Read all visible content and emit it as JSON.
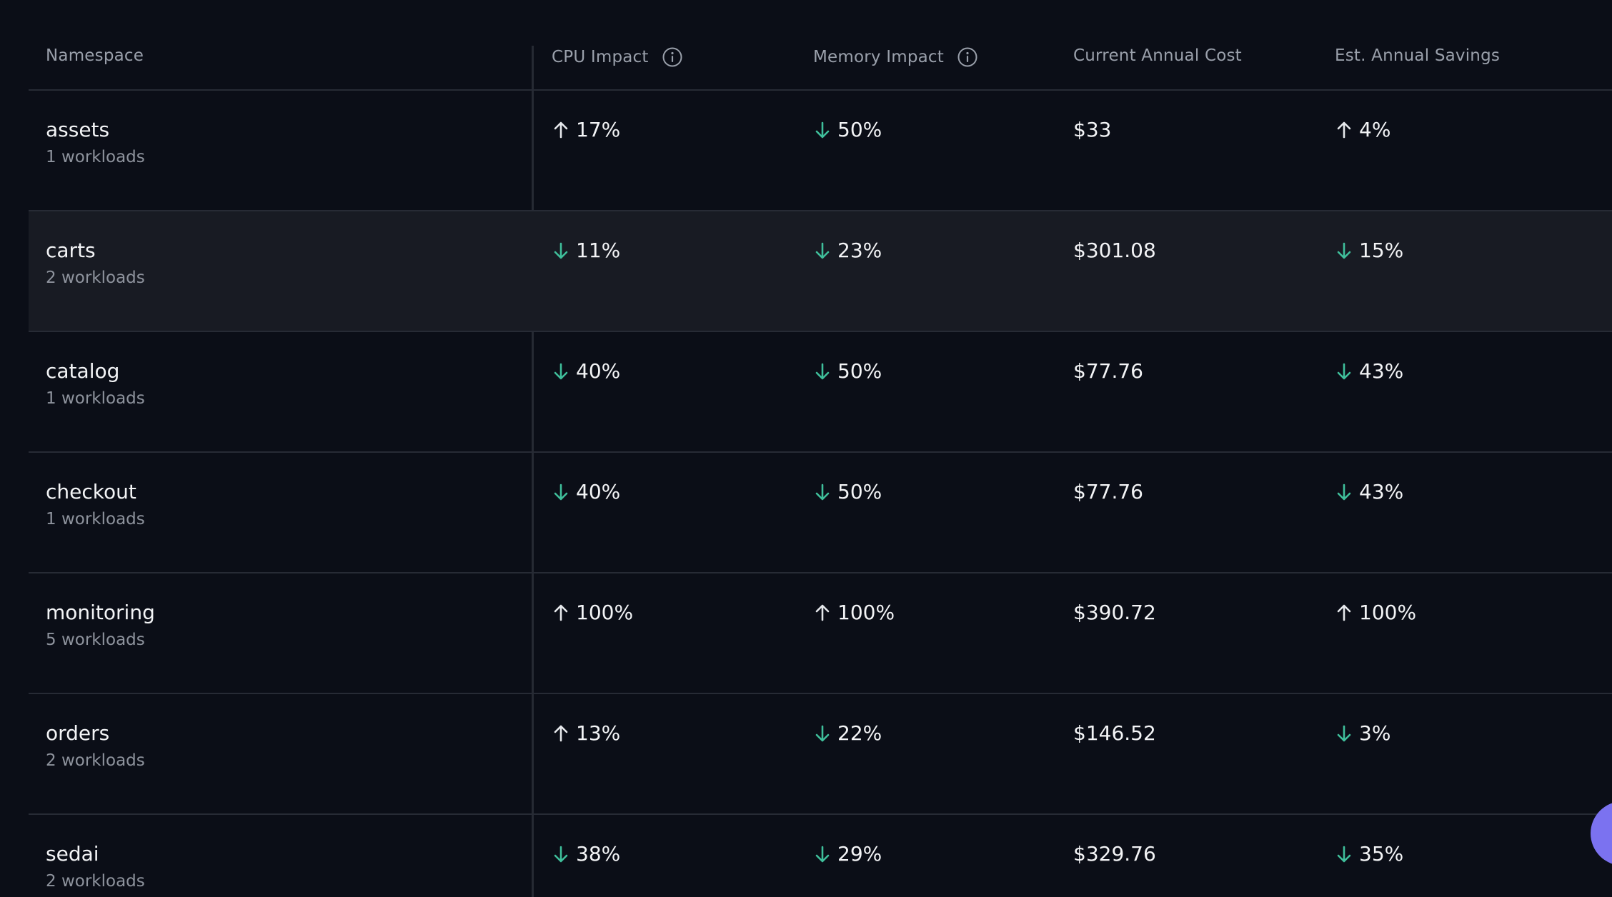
{
  "table": {
    "headers": {
      "namespace": "Namespace",
      "cpu_impact": "CPU Impact",
      "memory_impact": "Memory Impact",
      "current_annual_cost": "Current Annual Cost",
      "est_annual_savings": "Est. Annual Savings"
    },
    "rows": [
      {
        "name": "assets",
        "workloads": "1 workloads",
        "cpu": {
          "dir": "up",
          "value": "17%"
        },
        "memory": {
          "dir": "down",
          "value": "50%"
        },
        "cost": "$33",
        "savings": {
          "dir": "up",
          "value": "4%"
        }
      },
      {
        "name": "carts",
        "workloads": "2 workloads",
        "cpu": {
          "dir": "down",
          "value": "11%"
        },
        "memory": {
          "dir": "down",
          "value": "23%"
        },
        "cost": "$301.08",
        "savings": {
          "dir": "down",
          "value": "15%"
        }
      },
      {
        "name": "catalog",
        "workloads": "1 workloads",
        "cpu": {
          "dir": "down",
          "value": "40%"
        },
        "memory": {
          "dir": "down",
          "value": "50%"
        },
        "cost": "$77.76",
        "savings": {
          "dir": "down",
          "value": "43%"
        }
      },
      {
        "name": "checkout",
        "workloads": "1 workloads",
        "cpu": {
          "dir": "down",
          "value": "40%"
        },
        "memory": {
          "dir": "down",
          "value": "50%"
        },
        "cost": "$77.76",
        "savings": {
          "dir": "down",
          "value": "43%"
        }
      },
      {
        "name": "monitoring",
        "workloads": "5 workloads",
        "cpu": {
          "dir": "up",
          "value": "100%"
        },
        "memory": {
          "dir": "up",
          "value": "100%"
        },
        "cost": "$390.72",
        "savings": {
          "dir": "up",
          "value": "100%"
        }
      },
      {
        "name": "orders",
        "workloads": "2 workloads",
        "cpu": {
          "dir": "up",
          "value": "13%"
        },
        "memory": {
          "dir": "down",
          "value": "22%"
        },
        "cost": "$146.52",
        "savings": {
          "dir": "down",
          "value": "3%"
        }
      },
      {
        "name": "sedai",
        "workloads": "2 workloads",
        "cpu": {
          "dir": "down",
          "value": "38%"
        },
        "memory": {
          "dir": "down",
          "value": "29%"
        },
        "cost": "$329.76",
        "savings": {
          "dir": "down",
          "value": "35%"
        }
      }
    ],
    "highlighted_row": "carts"
  },
  "colors": {
    "background": "#0b0e17",
    "row_highlight": "#181b23",
    "up_arrow": "#e6e8ec",
    "down_arrow": "#3fbf9b",
    "fab": "#7b72f0"
  },
  "icons": {
    "info": "info-circle-icon",
    "up": "arrow-up-icon",
    "down": "arrow-down-icon"
  }
}
